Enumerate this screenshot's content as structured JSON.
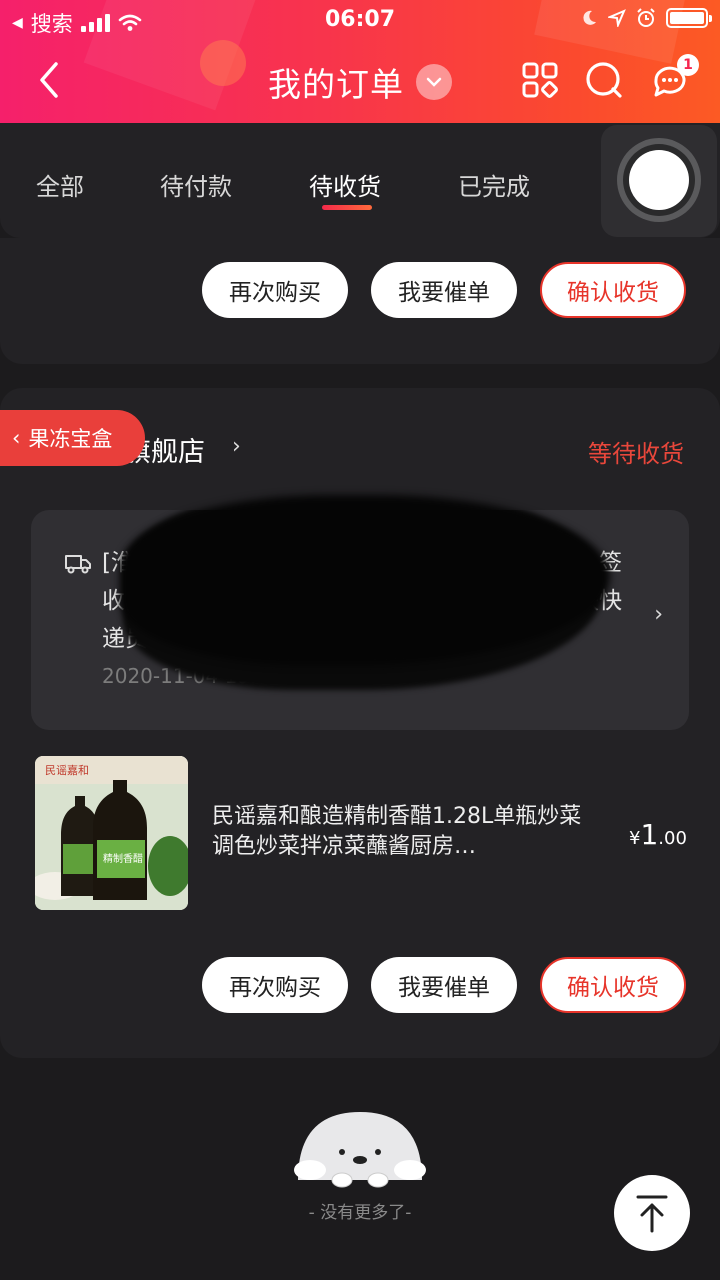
{
  "status_bar": {
    "back_app": "搜索",
    "time": "06:07"
  },
  "nav": {
    "title": "我的订单",
    "message_badge": "1"
  },
  "tabs": [
    {
      "label": "全部"
    },
    {
      "label": "待付款"
    },
    {
      "label": "待收货",
      "active": true
    },
    {
      "label": "已完成"
    }
  ],
  "order_prev": {
    "buttons": {
      "rebuy": "再次购买",
      "urge": "我要催单",
      "confirm": "确认收货"
    }
  },
  "jelly_tag": "果冻宝盒",
  "order": {
    "shop_name": "民谣旗舰店",
    "shop_name_visible": "旗舰店",
    "status": "等待收货",
    "logistics": {
      "line1_start": "[淮",
      "line1_end": "签",
      "line2_start": "收,",
      "line2_end": "联快",
      "line3_start": "递员",
      "date": "2020-11-04 19:39:03"
    },
    "product": {
      "title": "民谣嘉和酿造精制香醋1.28L单瓶炒菜调色炒菜拌凉菜蘸酱厨房…",
      "price_symbol": "¥",
      "price_int": "1",
      "price_dec": ".00"
    },
    "buttons": {
      "rebuy": "再次购买",
      "urge": "我要催单",
      "confirm": "确认收货"
    }
  },
  "footer": {
    "no_more": "- 没有更多了-"
  },
  "colors": {
    "header_start": "#f5206b",
    "header_end": "#fc5a24",
    "accent_red": "#e7342a",
    "bg": "#1c1b1d",
    "card": "#232225"
  }
}
